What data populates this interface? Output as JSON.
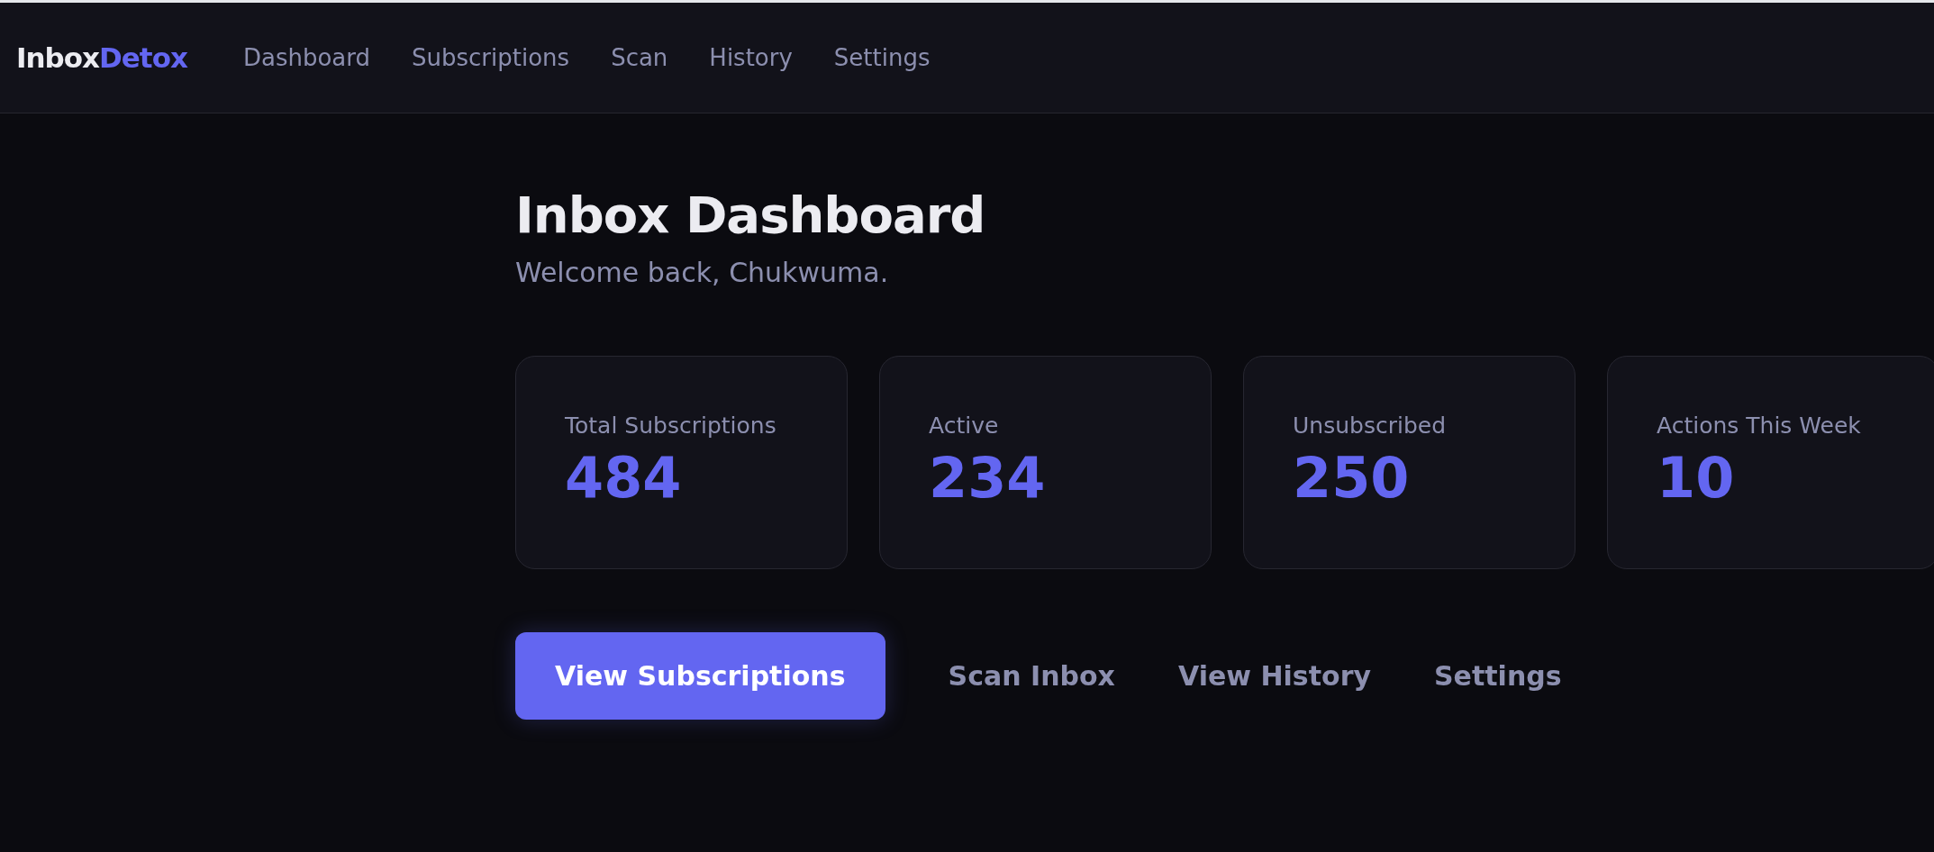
{
  "brand": {
    "first": "Inbox",
    "second": "Detox"
  },
  "nav": [
    "Dashboard",
    "Subscriptions",
    "Scan",
    "History",
    "Settings"
  ],
  "page": {
    "title": "Inbox Dashboard",
    "subtitle": "Welcome back, Chukwuma."
  },
  "stats": [
    {
      "label": "Total Subscriptions",
      "value": "484"
    },
    {
      "label": "Active",
      "value": "234"
    },
    {
      "label": "Unsubscribed",
      "value": "250"
    },
    {
      "label": "Actions This Week",
      "value": "10"
    }
  ],
  "actions": [
    {
      "label": "View Subscriptions",
      "kind": "primary"
    },
    {
      "label": "Scan Inbox",
      "kind": "ghost"
    },
    {
      "label": "View History",
      "kind": "ghost"
    },
    {
      "label": "Settings",
      "kind": "ghost"
    }
  ]
}
